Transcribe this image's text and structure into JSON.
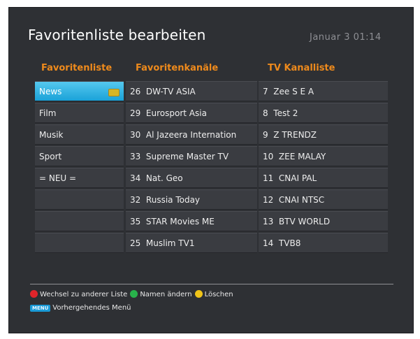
{
  "header": {
    "title": "Favoritenliste bearbeiten",
    "datetime": "Januar 3 01:14"
  },
  "columns": {
    "favorites": {
      "header": "Favoritenliste",
      "items": [
        "News",
        "Film",
        "Musik",
        "Sport",
        "= NEU ="
      ],
      "selected_index": 0
    },
    "favorite_channels": {
      "header": "Favoritenkanäle",
      "items": [
        {
          "num": "26",
          "name": "DW-TV ASIA"
        },
        {
          "num": "29",
          "name": "Eurosport Asia"
        },
        {
          "num": "30",
          "name": "Al Jazeera Internation"
        },
        {
          "num": "33",
          "name": "Supreme Master TV"
        },
        {
          "num": "34",
          "name": "Nat. Geo"
        },
        {
          "num": "32",
          "name": "Russia Today"
        },
        {
          "num": "35",
          "name": "STAR Movies ME"
        },
        {
          "num": "25",
          "name": "Muslim TV1"
        }
      ]
    },
    "tv_channels": {
      "header": "TV Kanalliste",
      "items": [
        {
          "num": "7",
          "name": "Zee S E A"
        },
        {
          "num": "8",
          "name": "Test 2"
        },
        {
          "num": "9",
          "name": "Z TRENDZ"
        },
        {
          "num": "10",
          "name": "ZEE MALAY"
        },
        {
          "num": "11",
          "name": "CNAI PAL"
        },
        {
          "num": "12",
          "name": "CNAI NTSC"
        },
        {
          "num": "13",
          "name": "BTV WORLD"
        },
        {
          "num": "14",
          "name": "TVB8"
        }
      ]
    }
  },
  "legend": {
    "red_label": "Wechsel zu anderer Liste",
    "green_label": "Namen ändern",
    "yellow_label": "Löschen",
    "menu_key": "MENU",
    "menu_label": "Vorhergehendes Menü"
  },
  "colors": {
    "accent_header": "#ee8a1c",
    "selection": "#1aa2d8",
    "red_key": "#e0242a",
    "green_key": "#28b24b",
    "yellow_key": "#f0c418",
    "blue_key": "#1a9ad6"
  },
  "icons": {
    "selected_item_tag": "tag-icon",
    "red_key": "red-button-icon",
    "green_key": "green-button-icon",
    "yellow_key": "yellow-button-icon",
    "menu_key": "menu-key-icon"
  }
}
